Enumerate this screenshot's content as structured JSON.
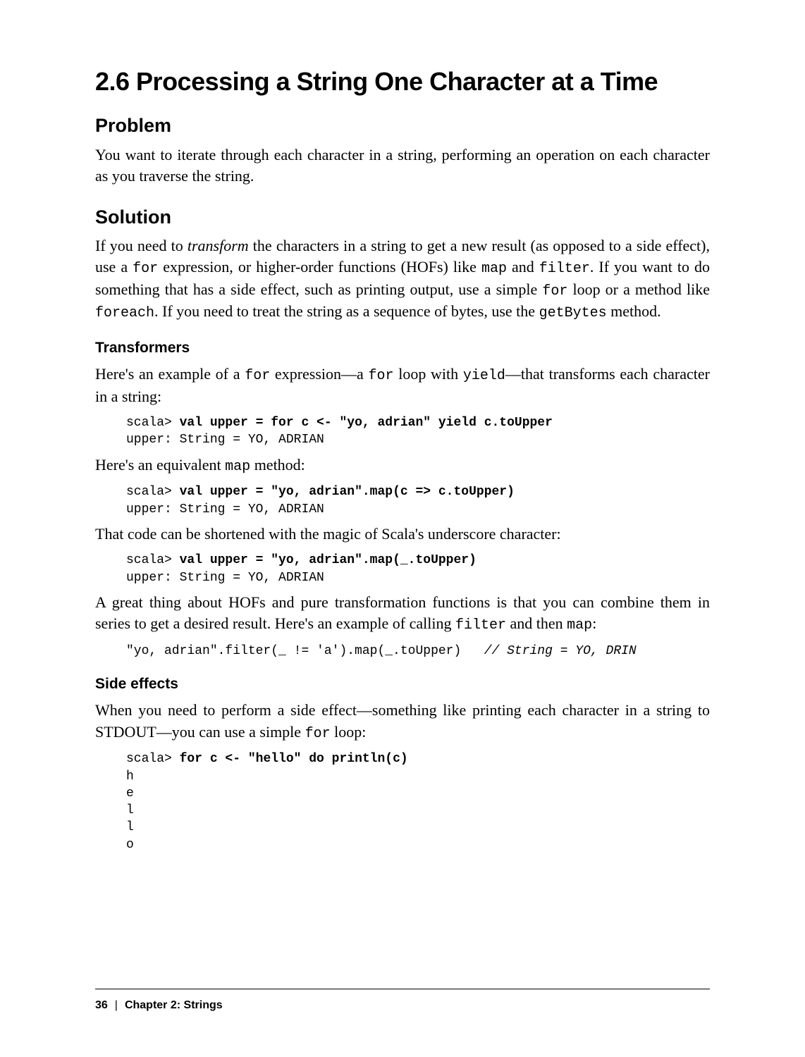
{
  "title": "2.6 Processing a String One Character at a Time",
  "sections": {
    "problem": {
      "heading": "Problem",
      "p1": "You want to iterate through each character in a string, performing an operation on each character as you traverse the string."
    },
    "solution": {
      "heading": "Solution",
      "p1_a": "If you need to ",
      "p1_em": "transform",
      "p1_b": " the characters in a string to get a new result (as opposed to a side effect), use a ",
      "p1_c1": "for",
      "p1_c": " expression, or higher-order functions (HOFs) like ",
      "p1_c2": "map",
      "p1_d": " and ",
      "p1_c3a": "fil",
      "p1_c3b": "ter",
      "p1_e": ". If you want to do something that has a side effect, such as printing output, use a simple ",
      "p1_c4": "for",
      "p1_f": " loop or a method like ",
      "p1_c5": "foreach",
      "p1_g": ". If you need to treat the string as a sequence of bytes, use the ",
      "p1_c6": "getBytes",
      "p1_h": " method."
    },
    "transformers": {
      "heading": "Transformers",
      "p1_a": "Here's an example of a ",
      "p1_c1": "for",
      "p1_b": " expression—a ",
      "p1_c2": "for",
      "p1_c": " loop with ",
      "p1_c3": "yield",
      "p1_d": "—that transforms each character in a string:",
      "code1_prompt": "scala> ",
      "code1_bold": "val upper = for c <- \"yo, adrian\" yield c.toUpper",
      "code1_out": "upper: String = YO, ADRIAN",
      "p2_a": "Here's an equivalent ",
      "p2_c1": "map",
      "p2_b": " method:",
      "code2_prompt": "scala> ",
      "code2_bold": "val upper = \"yo, adrian\".map(c => c.toUpper)",
      "code2_out": "upper: String = YO, ADRIAN",
      "p3": "That code can be shortened with the magic of Scala's underscore character:",
      "code3_prompt": "scala> ",
      "code3_bold": "val upper = \"yo, adrian\".map(_.toUpper)",
      "code3_out": "upper: String = YO, ADRIAN",
      "p4_a": "A great thing about HOFs and pure transformation functions is that you can combine them in series to get a desired result. Here's an example of calling ",
      "p4_c1": "filter",
      "p4_b": " and then ",
      "p4_c2": "map",
      "p4_c": ":",
      "code4_expr": "\"yo, adrian\".filter(_ != 'a').map(_.toUpper)   ",
      "code4_comment": "// String = YO, DRIN"
    },
    "sideeffects": {
      "heading": "Side effects",
      "p1_a": "When you need to perform a side effect—something like printing each character in a string to STDOUT—you can use a simple ",
      "p1_c1": "for",
      "p1_b": " loop:",
      "code1_prompt": "scala> ",
      "code1_bold": "for c <- \"hello\" do println(c)",
      "code1_out": "h\ne\nl\nl\no"
    }
  },
  "footer": {
    "page": "36",
    "sep": "|",
    "chapter": "Chapter 2: Strings"
  }
}
